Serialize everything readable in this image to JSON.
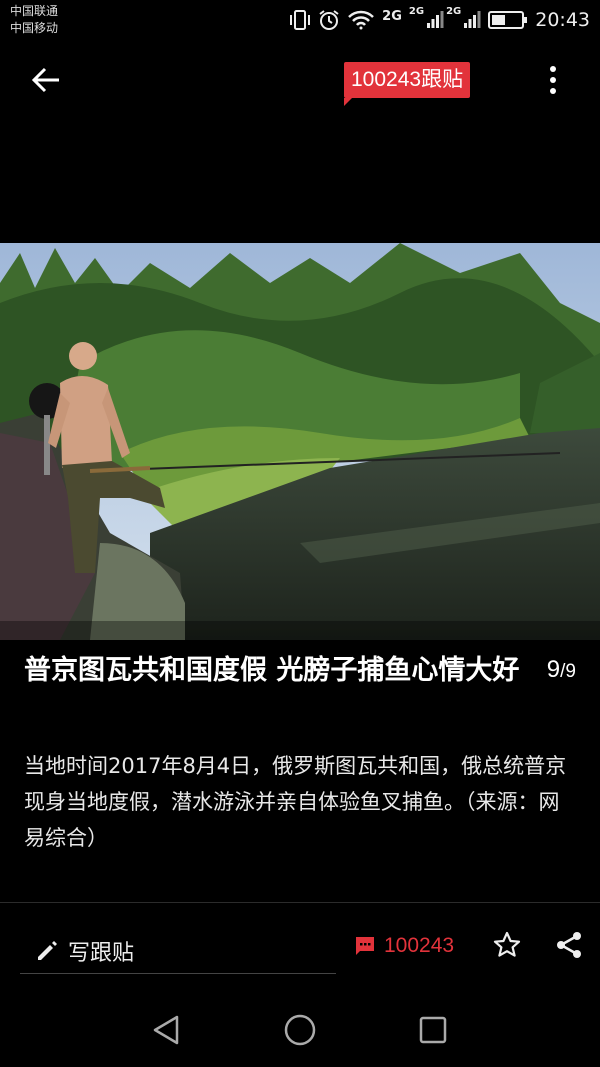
{
  "status_bar": {
    "carrier_1": "中国联通",
    "carrier_2": "中国移动",
    "network_1": "2G",
    "network_2": "2G",
    "network_3": "2G",
    "time": "20:43",
    "battery_level": 0.45,
    "icons": [
      "vibrate-icon",
      "alarm-icon",
      "wifi-icon",
      "signal-icon",
      "battery-icon"
    ]
  },
  "header": {
    "comment_badge": "100243跟贴"
  },
  "article": {
    "title": "普京图瓦共和国度假 光膀子捕鱼心情大好",
    "page_current": "9",
    "page_total": "/9",
    "description": "当地时间2017年8月4日，俄罗斯图瓦共和国，俄总统普京现身当地度假，潜水游泳并亲自体验鱼叉捕鱼。（来源：网易综合）"
  },
  "bottom_bar": {
    "write_reply_label": "写跟贴",
    "comment_count": "100243"
  },
  "colors": {
    "accent": "#e2333b",
    "background": "#000000"
  }
}
